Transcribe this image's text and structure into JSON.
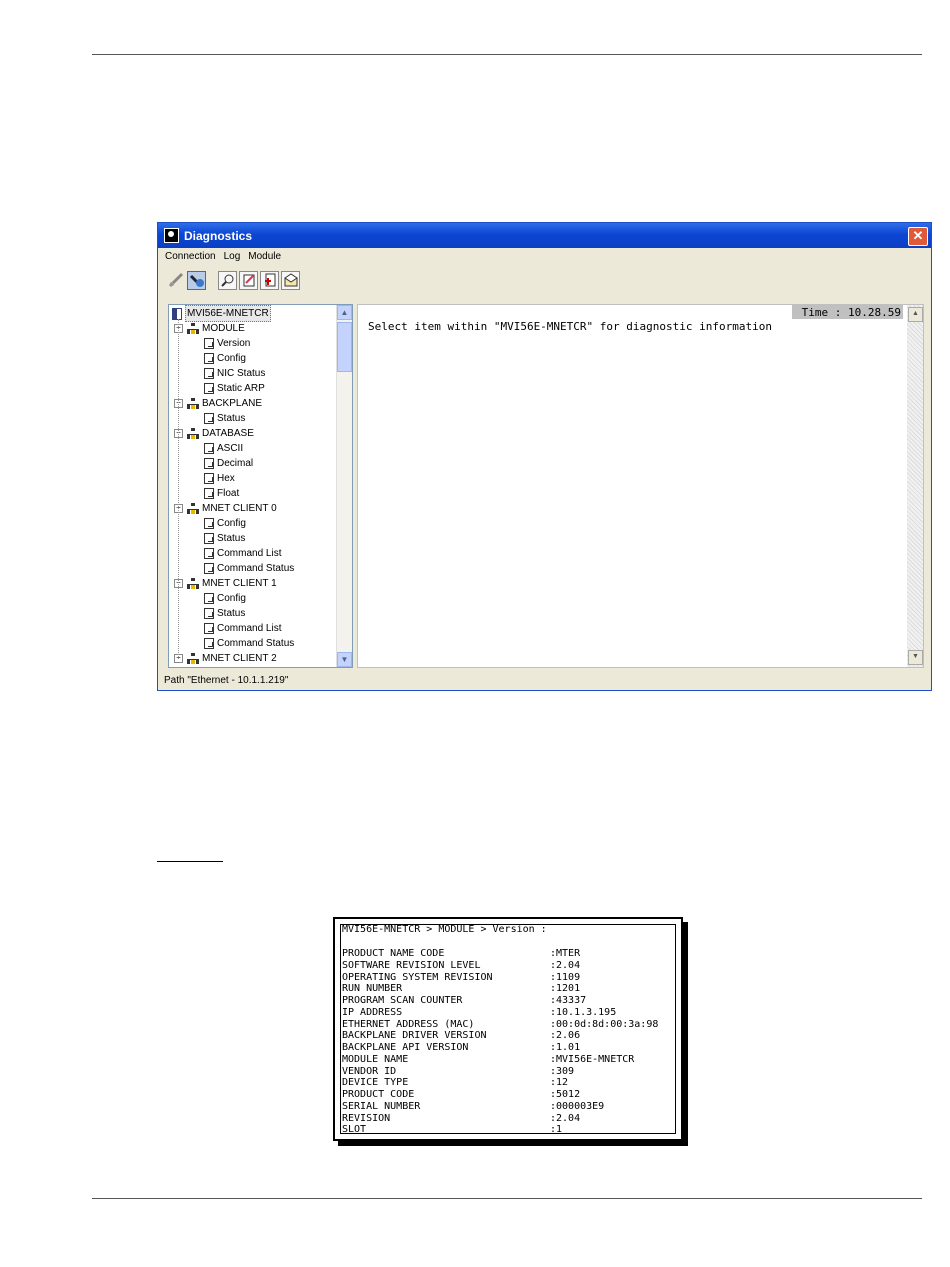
{
  "window": {
    "title": "Diagnostics",
    "close_glyph": "✕",
    "menu": [
      "Connection",
      "Log",
      "Module"
    ],
    "status_bar": "Path \"Ethernet - 10.1.1.219\""
  },
  "tree": {
    "root": "MVI56E-MNETCR",
    "nodes": [
      {
        "label": "MODULE",
        "children": [
          "Version",
          "Config",
          "NIC Status",
          "Static ARP"
        ]
      },
      {
        "label": "BACKPLANE",
        "children": [
          "Status"
        ]
      },
      {
        "label": "DATABASE",
        "children": [
          "ASCII",
          "Decimal",
          "Hex",
          "Float"
        ]
      },
      {
        "label": "MNET CLIENT 0",
        "children": [
          "Config",
          "Status",
          "Command List",
          "Command Status"
        ]
      },
      {
        "label": "MNET CLIENT 1",
        "children": [
          "Config",
          "Status",
          "Command List",
          "Command Status"
        ]
      },
      {
        "label": "MNET CLIENT 2",
        "children": []
      }
    ]
  },
  "info": {
    "time": "Time : 10.28.59",
    "message": "Select item within \"MVI56E-MNETCR\" for diagnostic information"
  },
  "version_box": {
    "header": "MVI56E-MNETCR > MODULE > Version :",
    "rows": [
      {
        "label": "PRODUCT NAME CODE",
        "value": ":MTER"
      },
      {
        "label": "SOFTWARE REVISION LEVEL",
        "value": ":2.04"
      },
      {
        "label": "OPERATING SYSTEM REVISION",
        "value": ":1109"
      },
      {
        "label": "RUN NUMBER",
        "value": ":1201"
      },
      {
        "label": "PROGRAM SCAN COUNTER",
        "value": ":43337"
      },
      {
        "label": "IP ADDRESS",
        "value": ":10.1.3.195"
      },
      {
        "label": "ETHERNET ADDRESS (MAC)",
        "value": ":00:0d:8d:00:3a:98"
      },
      {
        "label": "BACKPLANE DRIVER VERSION",
        "value": ":2.06"
      },
      {
        "label": "BACKPLANE API VERSION",
        "value": ":1.01"
      },
      {
        "label": "MODULE NAME",
        "value": ":MVI56E-MNETCR"
      },
      {
        "label": "VENDOR ID",
        "value": ":309"
      },
      {
        "label": "DEVICE TYPE",
        "value": ":12"
      },
      {
        "label": "PRODUCT CODE",
        "value": ":5012"
      },
      {
        "label": "SERIAL NUMBER",
        "value": ":000003E9"
      },
      {
        "label": "REVISION",
        "value": ":2.04"
      },
      {
        "label": "SLOT",
        "value": ":1"
      }
    ]
  },
  "toolbar_icons": [
    "disconnect-icon",
    "connect-icon",
    "search-icon",
    "log-icon",
    "file-icon",
    "mail-icon"
  ]
}
